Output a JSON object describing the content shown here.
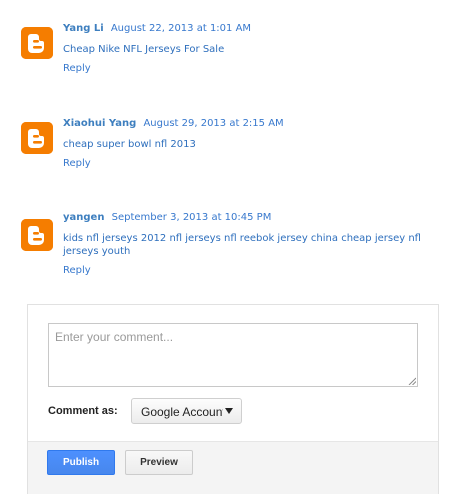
{
  "comments": [
    {
      "author": "Yang Li",
      "timestamp": "August 22, 2013 at 1:01 AM",
      "text": "Cheap Nike NFL Jerseys For Sale",
      "reply_label": "Reply",
      "avatar_icon": "blogger-icon"
    },
    {
      "author": "Xiaohui Yang",
      "timestamp": "August 29, 2013 at 2:15 AM",
      "text": "cheap super bowl nfl 2013",
      "reply_label": "Reply",
      "avatar_icon": "blogger-icon"
    },
    {
      "author": "yangen",
      "timestamp": "September 3, 2013 at 10:45 PM",
      "text": "kids nfl jerseys 2012 nfl jerseys nfl reebok jersey china cheap jersey nfl jerseys youth",
      "reply_label": "Reply",
      "avatar_icon": "blogger-icon"
    }
  ],
  "form": {
    "comment_placeholder": "Enter your comment...",
    "comment_value": "",
    "comment_as_label": "Comment as:",
    "account_selected": "Google Account",
    "publish_label": "Publish",
    "preview_label": "Preview"
  },
  "colors": {
    "link": "#3778cd",
    "avatar": "#f57d00",
    "publish": "#4d90fe"
  }
}
